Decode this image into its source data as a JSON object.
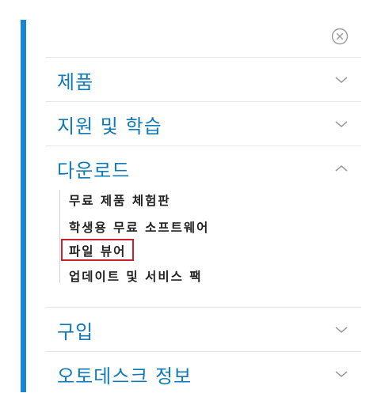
{
  "menu": {
    "sections": [
      {
        "label": "제품",
        "state": "collapsed"
      },
      {
        "label": "지원 및 학습",
        "state": "collapsed"
      },
      {
        "label": "다운로드",
        "state": "expanded"
      },
      {
        "label": "구입",
        "state": "collapsed"
      },
      {
        "label": "오토데스크 정보",
        "state": "collapsed"
      }
    ],
    "downloads_items": [
      "무료 제품 체험판",
      "학생용 무료 소프트웨어",
      "파일 뷰어",
      "업데이트 및 서비스 팩"
    ],
    "highlighted_item": "파일 뷰어"
  },
  "icons": {
    "close": "close-circle-icon",
    "collapsed": "chevron-down-icon",
    "expanded": "chevron-up-icon"
  },
  "colors": {
    "accent_bar": "#1a86d1",
    "section_text": "#0f7ab6",
    "highlight_border": "#c8232c",
    "icon_gray": "#9a9a9a"
  }
}
